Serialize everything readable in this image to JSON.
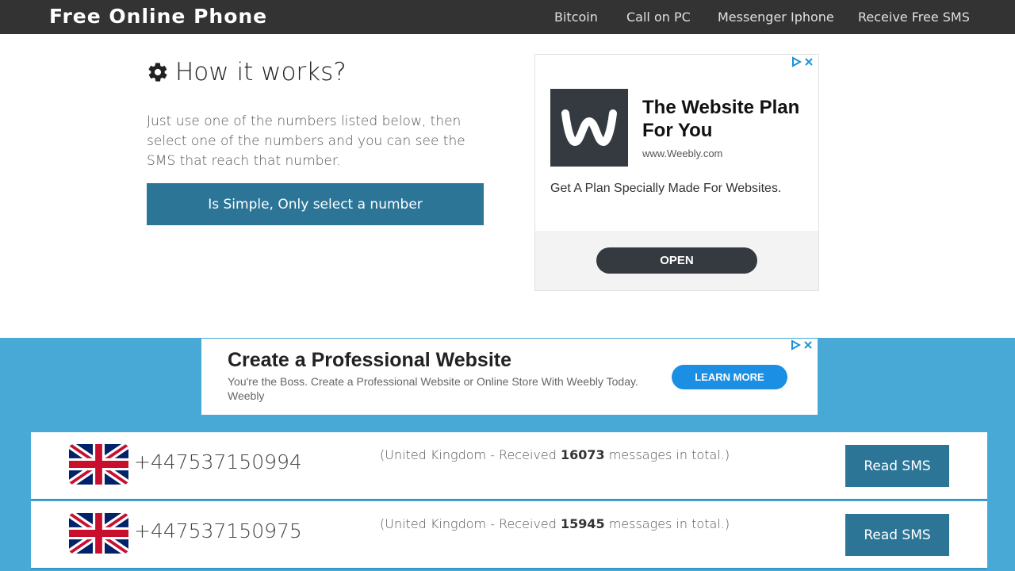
{
  "nav": {
    "brand": "Free Online Phone",
    "links": [
      "Bitcoin",
      "Call on PC",
      "Messenger Iphone",
      "Receive Free SMS"
    ]
  },
  "how": {
    "title": "How it works?",
    "text": "Just use one of the numbers listed below, then select one of the numbers and you can see the SMS that reach that number.",
    "button": "Is Simple, Only select a number"
  },
  "ad1": {
    "headline": "The Website Plan For You",
    "url": "www.Weebly.com",
    "description": "Get A Plan Specially Made For Websites.",
    "cta": "OPEN"
  },
  "ad2": {
    "headline": "Create a Professional Website",
    "description": "You're the Boss. Create a Professional Website or Online Store With Weebly Today. Weebly",
    "cta": "LEARN MORE"
  },
  "numbers": [
    {
      "number": "+447537150994",
      "info_prefix": "(United Kingdom - Received ",
      "count": "16073",
      "info_suffix": " messages in total.)",
      "button": "Read SMS"
    },
    {
      "number": "+447537150975",
      "info_prefix": "(United Kingdom - Received ",
      "count": "15945",
      "info_suffix": " messages in total.)",
      "button": "Read SMS"
    }
  ],
  "colors": {
    "navbar": "#333333",
    "primary_button": "#2c7597",
    "band": "#49a9d6"
  },
  "icons": [
    "gear-icon",
    "adchoices-icon",
    "close-icon",
    "uk-flag-icon",
    "weebly-logo"
  ]
}
